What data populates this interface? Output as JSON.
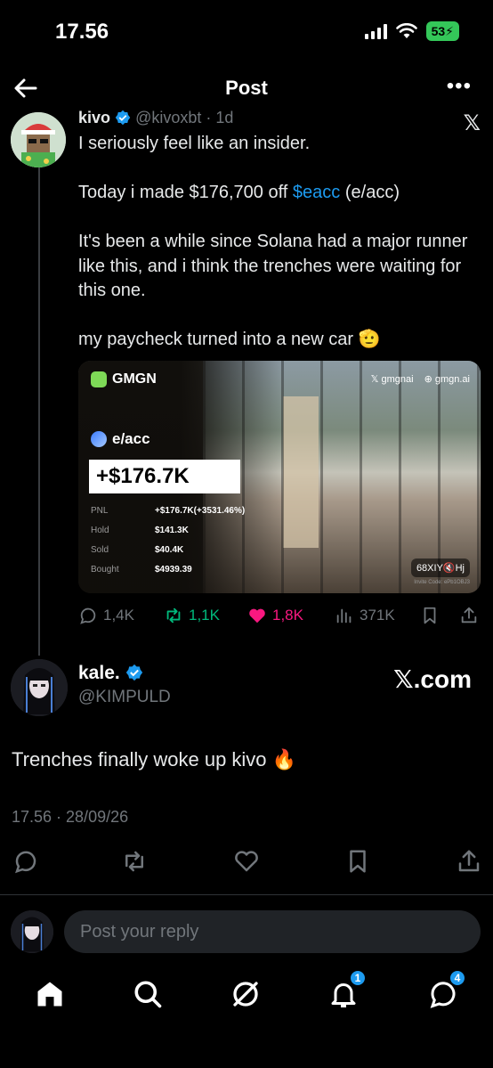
{
  "status_bar": {
    "time": "17.56",
    "battery": "53"
  },
  "nav": {
    "title": "Post"
  },
  "quoted_post": {
    "author_name": "kivo",
    "author_handle": "@kivoxbt",
    "age": "1d",
    "text_line1": "I seriously feel like an insider.",
    "text_pre": "Today i made $176,700 off ",
    "cashtag": "$eacc",
    "text_post": " (e/acc)",
    "text_para3": "It's been a while since Solana had a major runner like this, and i think the trenches were waiting for this one.",
    "text_para4": "my paycheck turned into a new car 🫡",
    "media": {
      "brand": "GMGN",
      "link1": "gmgnai",
      "link2": "gmgn.ai",
      "token": "e/acc",
      "pnl_big": "+$176.7K",
      "stats": [
        {
          "label": "PNL",
          "value": "+$176.7K(+3531.46%)"
        },
        {
          "label": "Hold",
          "value": "$141.3K"
        },
        {
          "label": "Sold",
          "value": "$40.4K"
        },
        {
          "label": "Bought",
          "value": "$4939.39"
        }
      ],
      "chip": "68XIY",
      "chip_suffix": "Hj",
      "invite": "Invite Code: ePb1OBJ3"
    },
    "actions": {
      "replies": "1,4K",
      "reposts": "1,1K",
      "likes": "1,8K",
      "views": "371K"
    }
  },
  "main_post": {
    "author_name": "kale.",
    "author_handle": "@KIMPULD",
    "source": "𝕏.com",
    "text": "Trenches finally woke up kivo 🔥",
    "timestamp": "17.56 · 28/09/26"
  },
  "reply": {
    "placeholder": "Post your reply"
  },
  "tabs": {
    "notifications_badge": "1",
    "messages_badge": "4"
  },
  "colors": {
    "accent": "#1d9bf0",
    "like": "#f91880",
    "repost": "#00ba7c",
    "muted": "#71767b"
  }
}
